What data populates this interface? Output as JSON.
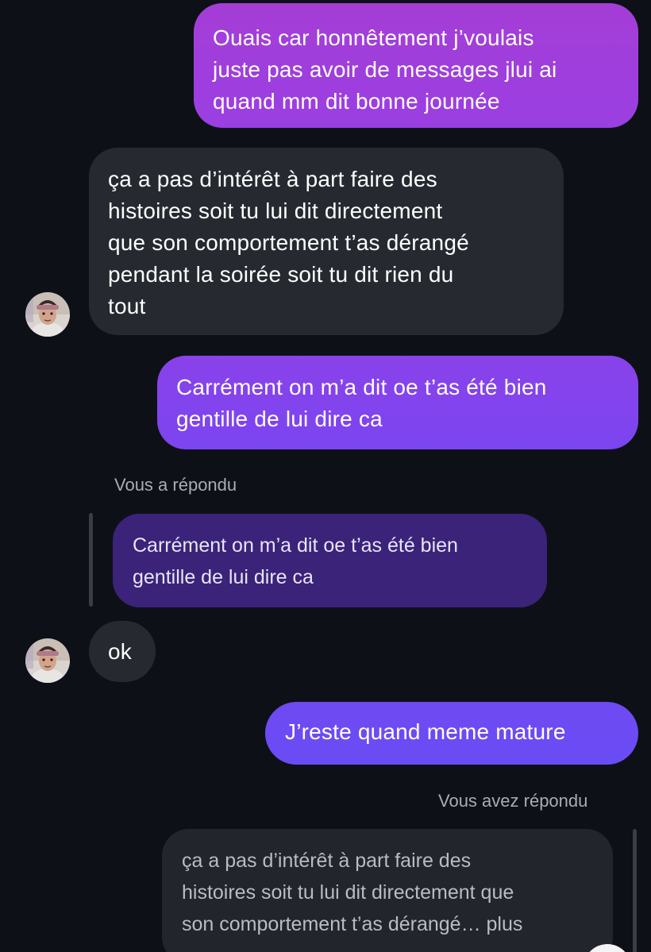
{
  "conversation": {
    "messages": [
      {
        "from": "me",
        "text": "Ouais car honnêtement j’voulais\njuste pas avoir de messages jlui ai\nquand mm dit bonne journée"
      },
      {
        "from": "contact",
        "text": "ça a pas d’intérêt à part faire des\nhistoires soit tu lui dit directement\nque son comportement t’as dérangé\npendant la soirée soit tu dit rien du\ntout"
      },
      {
        "from": "me",
        "text": "Carrément on m’a dit oe t’as été bien\ngentille de lui dire ca"
      },
      {
        "from": "contact",
        "reply_label": "Vous a répondu",
        "quoted_text": "Carrément on m’a dit oe t’as été bien\ngentille de lui dire ca",
        "text": "ok"
      },
      {
        "from": "me",
        "text": "J’reste quand meme mature"
      },
      {
        "from": "me",
        "reply_label": "Vous avez répondu",
        "quoted_text": "ça a pas d’intérêt à part faire des\nhistoires soit tu lui dit directement que\nson comportement t’as dérangé… plus"
      }
    ]
  },
  "colors": {
    "background": "#0d1117",
    "sent_gradient_top": "#a13ed8",
    "sent_gradient_mid": "#8a3ff0",
    "sent_gradient_bottom": "#6a4cf5",
    "received_bubble": "#262a30",
    "quoted_sent_bubble": "#3a2379",
    "quoted_received_bubble": "#22252b",
    "muted_text": "#a8acb3"
  },
  "icons": {
    "avatar": "contact-avatar"
  }
}
